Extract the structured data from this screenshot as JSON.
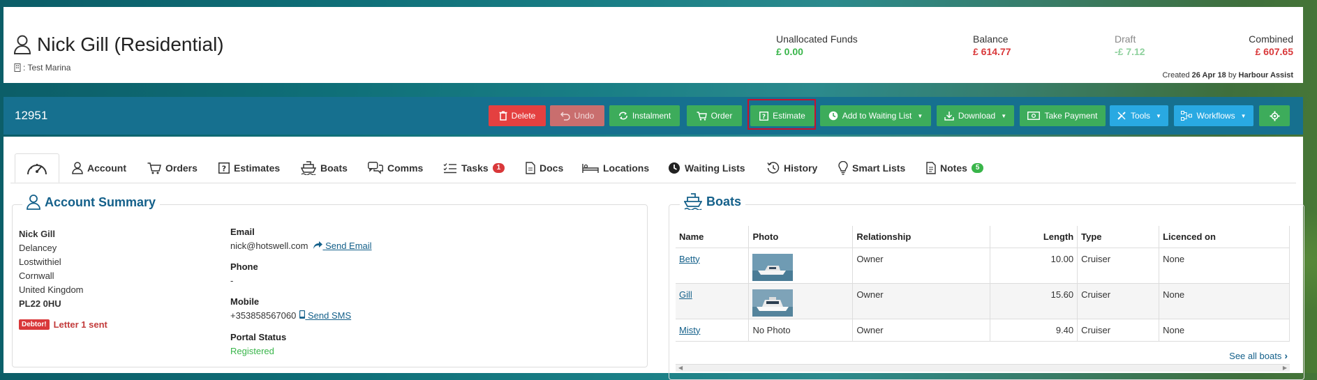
{
  "customer": {
    "name": "Nick Gill (Residential)",
    "marina": ": Test Marina",
    "created_prefix": "Created",
    "created_date": "26 Apr 18",
    "created_by_prefix": "by",
    "created_by": "Harbour Assist"
  },
  "funds": {
    "unallocated_label": "Unallocated Funds",
    "unallocated_value": "£ 0.00",
    "balance_label": "Balance",
    "balance_value": "£ 614.77",
    "draft_label": "Draft",
    "draft_value": "-£ 7.12",
    "combined_label": "Combined",
    "combined_value": "£ 607.65",
    "colors": {
      "green": "#39b54a",
      "red": "#d9383a",
      "draft_green": "#8fd19e"
    }
  },
  "toolbar": {
    "record_id": "12951",
    "delete": "Delete",
    "undo": "Undo",
    "instalment": "Instalment",
    "order": "Order",
    "estimate": "Estimate",
    "add_waiting": "Add to Waiting List",
    "download": "Download",
    "take_payment": "Take Payment",
    "tools": "Tools",
    "workflows": "Workflows",
    "settings_icon": "gear-icon"
  },
  "tabs": [
    {
      "label": "",
      "icon": "dashboard-icon"
    },
    {
      "label": "Account",
      "icon": "user-icon"
    },
    {
      "label": "Orders",
      "icon": "cart-icon"
    },
    {
      "label": "Estimates",
      "icon": "question-icon"
    },
    {
      "label": "Boats",
      "icon": "ship-icon"
    },
    {
      "label": "Comms",
      "icon": "chat-icon"
    },
    {
      "label": "Tasks",
      "icon": "list-icon",
      "badge": "1"
    },
    {
      "label": "Docs",
      "icon": "doc-icon"
    },
    {
      "label": "Locations",
      "icon": "bed-icon"
    },
    {
      "label": "Waiting Lists",
      "icon": "clock-icon"
    },
    {
      "label": "History",
      "icon": "history-icon"
    },
    {
      "label": "Smart Lists",
      "icon": "bulb-icon"
    },
    {
      "label": "Notes",
      "icon": "note-icon",
      "badge": "5"
    }
  ],
  "account_summary": {
    "title": "Account Summary",
    "address": [
      "Nick Gill",
      "Delancey",
      "Lostwithiel",
      "Cornwall",
      "United Kingdom",
      "PL22 0HU"
    ],
    "debtor_tag": "Debtor!",
    "letter_status": "Letter 1 sent",
    "email_label": "Email",
    "email_value": "nick@hotswell.com",
    "send_email": "Send Email",
    "phone_label": "Phone",
    "phone_value": "-",
    "mobile_label": "Mobile",
    "mobile_value": "+353858567060",
    "send_sms": "Send SMS",
    "portal_label": "Portal Status",
    "portal_value": "Registered"
  },
  "boats": {
    "title": "Boats",
    "columns": [
      "Name",
      "Photo",
      "Relationship",
      "Length",
      "Type",
      "Licenced on"
    ],
    "rows": [
      {
        "name": "Betty",
        "photo": "",
        "relationship": "Owner",
        "length": "10.00",
        "type": "Cruiser",
        "licenced": "None"
      },
      {
        "name": "Gill",
        "photo": "",
        "relationship": "Owner",
        "length": "15.60",
        "type": "Cruiser",
        "licenced": "None"
      },
      {
        "name": "Misty",
        "photo": "No Photo",
        "relationship": "Owner",
        "length": "9.40",
        "type": "Cruiser",
        "licenced": "None"
      }
    ],
    "see_all": "See all boats"
  }
}
